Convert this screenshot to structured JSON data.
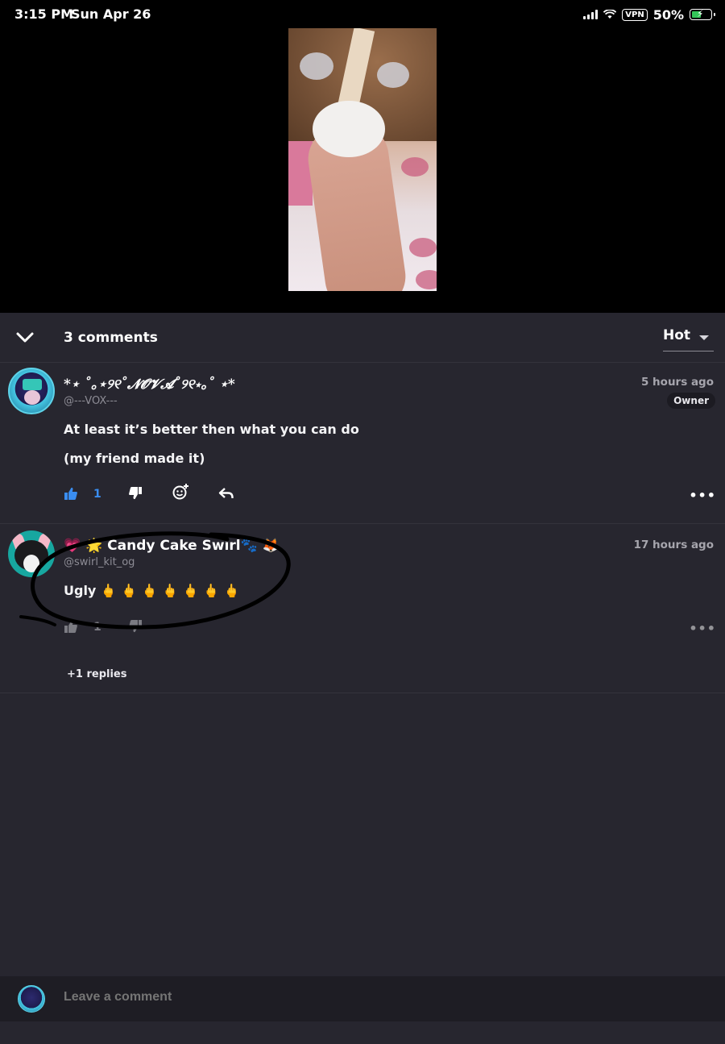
{
  "status_bar": {
    "time": "3:15 PM",
    "date": "Sun Apr 26",
    "vpn": "VPN",
    "battery": "50%"
  },
  "comments_header": {
    "count_label": "3 comments",
    "sort_label": "Hot"
  },
  "comments": [
    {
      "author": "*⋆ ˚｡⋆୨୧˚𝓝𝓞𝓥𝓐˚୨୧⋆｡˚ ⋆*",
      "handle": "@---VOX---",
      "time": "5 hours ago",
      "badge": "Owner",
      "lines": [
        "At least it’s better then what you can do",
        "(my friend made it)"
      ],
      "likes": "1",
      "more": "•••"
    },
    {
      "author": "💗 🌟 Candy Cake Swirl🐾 🦊",
      "handle": "@swirl_kit_og",
      "time": "17 hours ago",
      "lines": [
        "Ugly 🖕 🖕 🖕 🖕 🖕 🖕 🖕"
      ],
      "likes": "1",
      "more": "•••",
      "replies": "+1 replies"
    }
  ],
  "composer": {
    "placeholder": "Leave a comment"
  },
  "colors": {
    "background": "#27262f",
    "like_accent": "#3a8df0",
    "owner_badge": "#1c1b22"
  }
}
